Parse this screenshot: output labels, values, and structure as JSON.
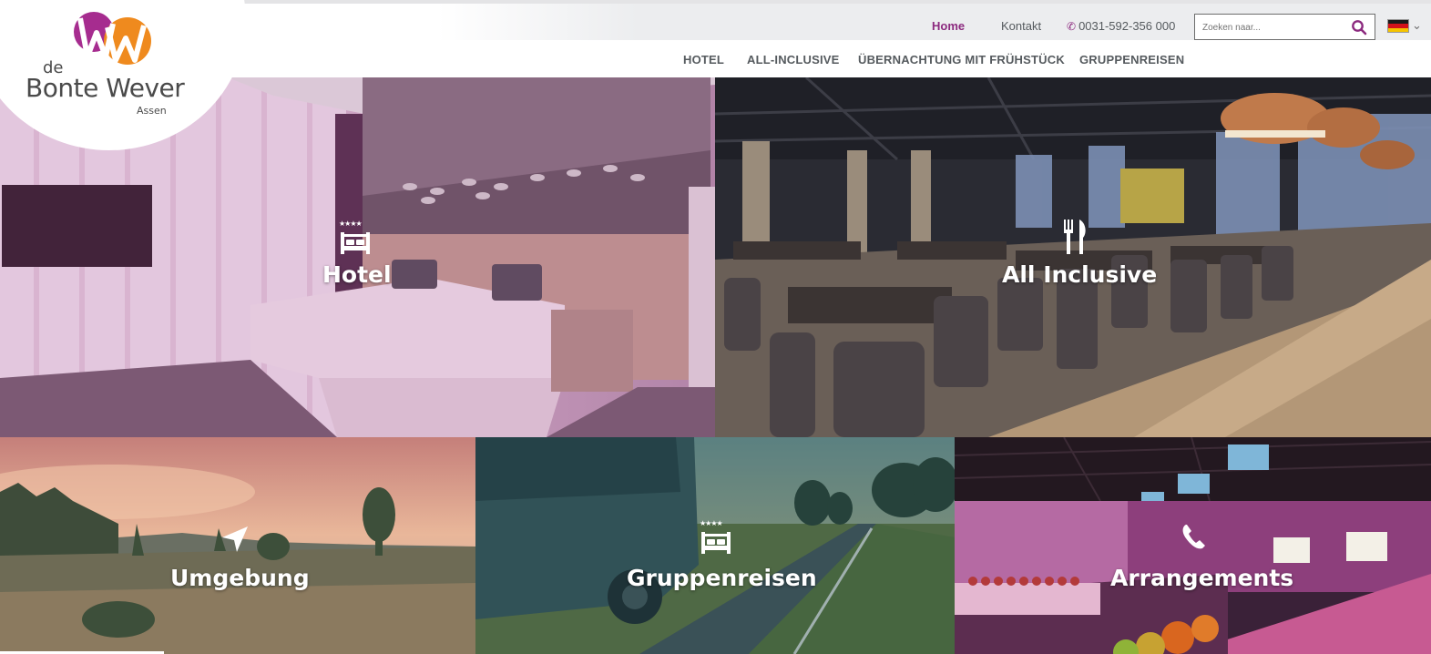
{
  "brand": {
    "logo_de": "de",
    "logo_name": "Bonte Wever",
    "logo_city": "Assen"
  },
  "topnav": {
    "home": "Home",
    "contact": "Kontakt",
    "phone": "0031-592-356 000",
    "search_placeholder": "Zoeken naar..."
  },
  "mainnav": {
    "items": [
      "HOTEL",
      "ALL-INCLUSIVE",
      "ÜBERNACHTUNG MIT FRÜHSTÜCK",
      "GRUPPENREISEN"
    ]
  },
  "tiles": {
    "hotel": {
      "label": "Hotel",
      "stars": "★★★★",
      "icon": "bed-icon"
    },
    "allinclusive": {
      "label": "All Inclusive",
      "icon": "cutlery-icon"
    },
    "umgebung": {
      "label": "Umgebung",
      "icon": "location-arrow-icon"
    },
    "gruppenreisen": {
      "label": "Gruppenreisen",
      "stars": "★★★★",
      "icon": "bed-icon"
    },
    "arrangements": {
      "label": "Arrangements",
      "icon": "phone-icon"
    }
  },
  "colors": {
    "brand_purple": "#8c2a7f",
    "brand_orange": "#ef8a1e",
    "nav_text": "#555a5e"
  }
}
